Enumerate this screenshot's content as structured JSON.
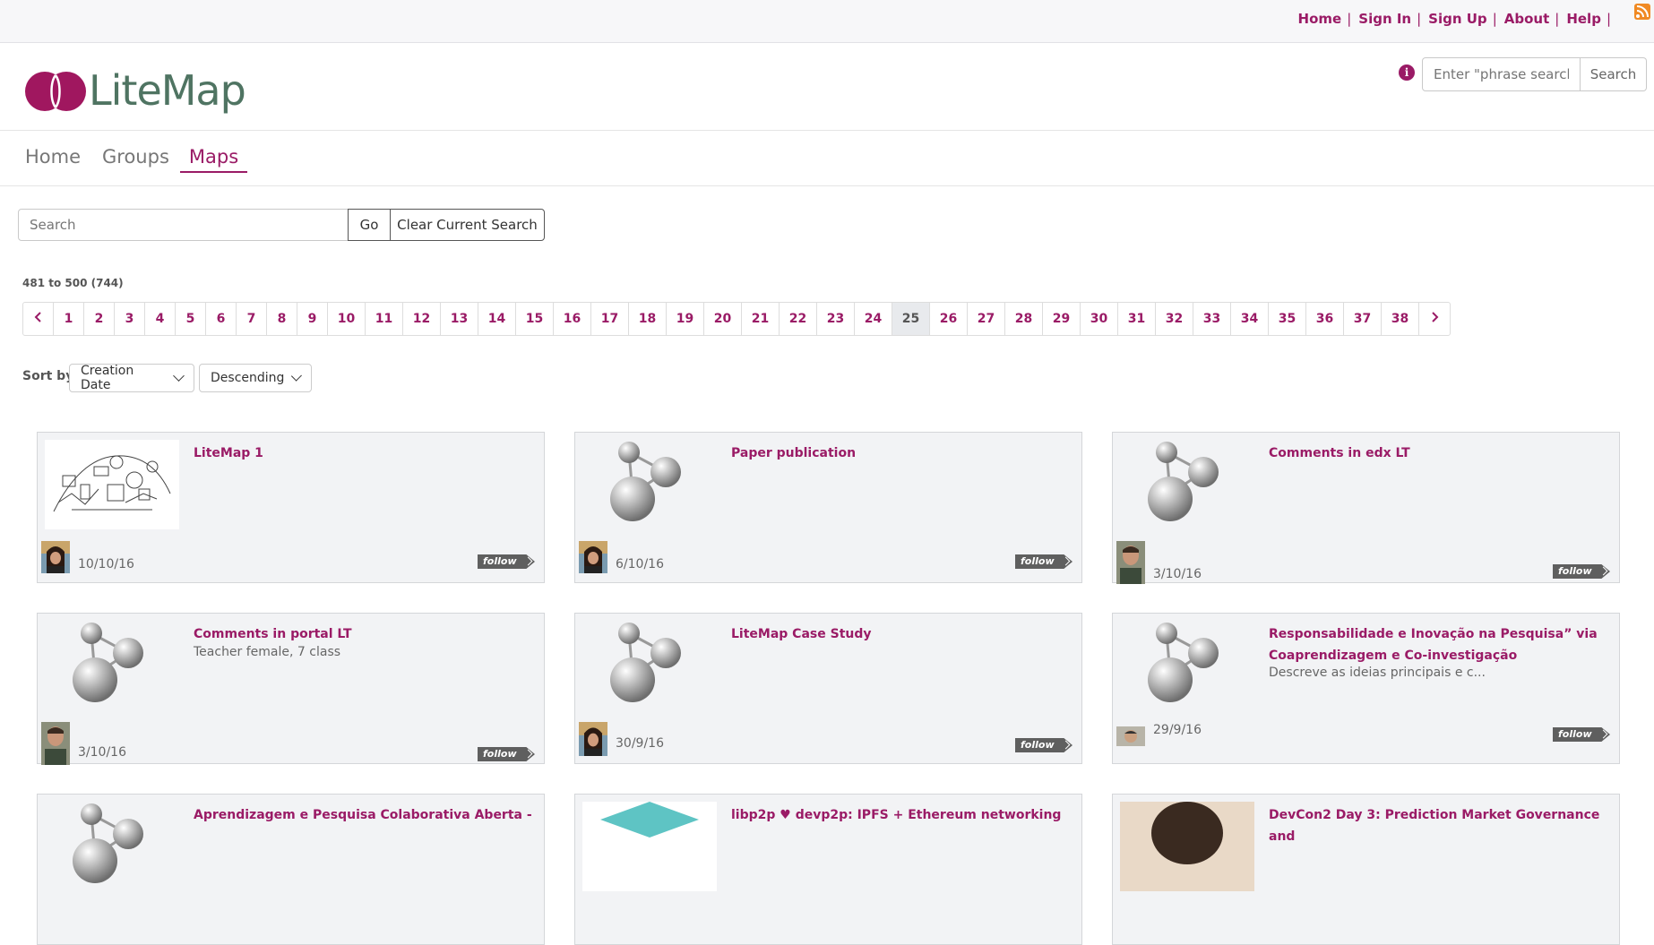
{
  "toplinks": {
    "home": "Home",
    "signin": "Sign In",
    "signup": "Sign Up",
    "about": "About",
    "help": "Help",
    "sep": "|"
  },
  "header": {
    "logo_text": "LiteMap",
    "search_placeholder": "Enter \"phrase search\"",
    "search_button": "Search"
  },
  "nav": {
    "home": "Home",
    "groups": "Groups",
    "maps": "Maps",
    "active": "Maps"
  },
  "search": {
    "placeholder": "Search",
    "go": "Go",
    "clear": "Clear Current Search"
  },
  "results": {
    "count": "481 to 500 (744)"
  },
  "pagination": {
    "pages": [
      "1",
      "2",
      "3",
      "4",
      "5",
      "6",
      "7",
      "8",
      "9",
      "10",
      "11",
      "12",
      "13",
      "14",
      "15",
      "16",
      "17",
      "18",
      "19",
      "20",
      "21",
      "22",
      "23",
      "24",
      "25",
      "26",
      "27",
      "28",
      "29",
      "30",
      "31",
      "32",
      "33",
      "34",
      "35",
      "36",
      "37",
      "38"
    ],
    "current": "25"
  },
  "sort": {
    "label": "Sort by",
    "field": "Creation Date",
    "order": "Descending"
  },
  "cards": [
    {
      "title": "LiteMap 1",
      "desc": "",
      "date": "10/10/16",
      "follow": "follow",
      "thumb": "sketch",
      "avatar": "woman"
    },
    {
      "title": "Paper publication",
      "desc": "",
      "date": "6/10/16",
      "follow": "follow",
      "thumb": "molecule",
      "avatar": "woman"
    },
    {
      "title": "Comments in edx LT",
      "desc": "",
      "date": "3/10/16",
      "follow": "follow",
      "thumb": "molecule",
      "avatar": "man"
    },
    {
      "title": "Comments in portal LT",
      "desc": "Teacher female, 7 class",
      "date": "3/10/16",
      "follow": "follow",
      "thumb": "molecule",
      "avatar": "man"
    },
    {
      "title": "LiteMap Case Study",
      "desc": "",
      "date": "30/9/16",
      "follow": "follow",
      "thumb": "molecule",
      "avatar": "woman"
    },
    {
      "title": "Responsabilidade e Inovação na Pesquisa” via Coaprendizagem e Co-investigação",
      "desc": "Descreve as ideias principais e c...",
      "date": "29/9/16",
      "follow": "follow",
      "thumb": "molecule",
      "avatar": "man-small"
    },
    {
      "title": "Aprendizagem e Pesquisa Colaborativa Aberta -",
      "desc": "",
      "date": "",
      "follow": "",
      "thumb": "molecule",
      "avatar": ""
    },
    {
      "title": "libp2p ♥ devp2p: IPFS + Ethereum networking",
      "desc": "",
      "date": "",
      "follow": "",
      "thumb": "teal",
      "avatar": ""
    },
    {
      "title": "DevCon2 Day 3: Prediction Market Governance and",
      "desc": "",
      "date": "",
      "follow": "",
      "thumb": "photo",
      "avatar": ""
    }
  ],
  "colors": {
    "accent": "#9a1b66",
    "logo_text": "#4f7462",
    "card_bg": "#f2f3f5"
  }
}
